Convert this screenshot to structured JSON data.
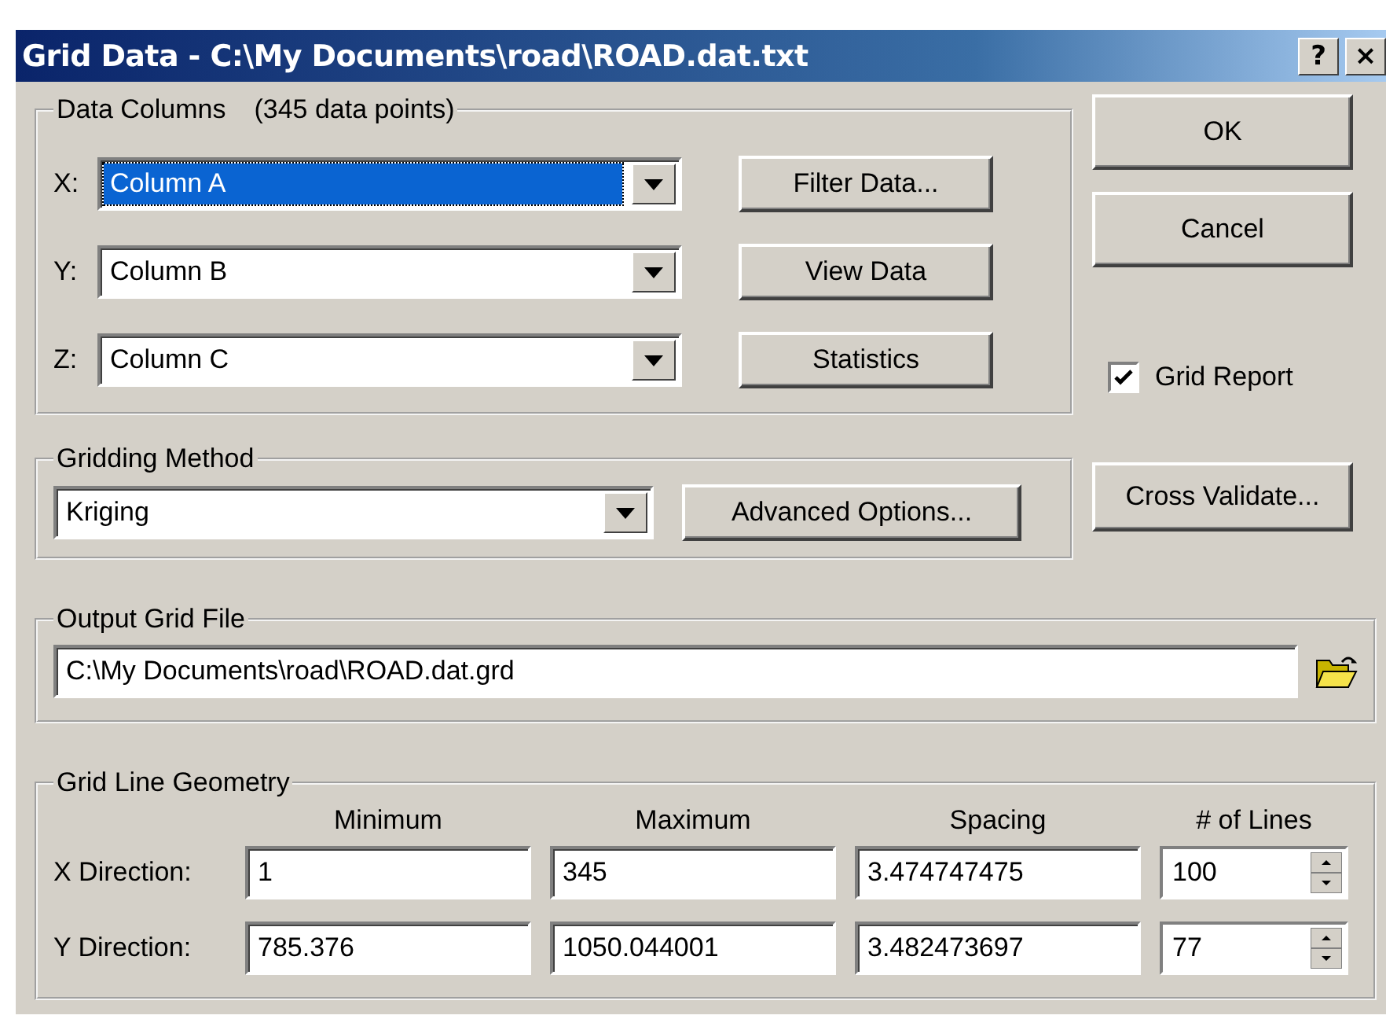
{
  "window": {
    "title": "Grid Data - C:\\My Documents\\road\\ROAD.dat.txt",
    "title_buttons": [
      "?",
      "×"
    ]
  },
  "data_columns": {
    "title": "Data Columns",
    "count": "(345 data points)",
    "rows": [
      {
        "axis": "X:",
        "value": "Column A",
        "focused": true,
        "button": "Filter Data..."
      },
      {
        "axis": "Y:",
        "value": "Column B",
        "focused": false,
        "button": "View Data"
      },
      {
        "axis": "Z:",
        "value": "Column C",
        "focused": false,
        "button": "Statistics"
      }
    ]
  },
  "side_buttons": [
    "OK",
    "Cancel"
  ],
  "grid_report": {
    "label": "Grid Report",
    "checked": true
  },
  "gridding_method": {
    "title": "Gridding Method",
    "value": "Kriging",
    "button": "Advanced Options..."
  },
  "cross_validate": "Cross Validate...",
  "output_grid_file": {
    "title": "Output Grid File",
    "value": "C:\\My Documents\\road\\ROAD.dat.grd"
  },
  "grid_line_geometry": {
    "title": "Grid Line Geometry",
    "columns": [
      "Minimum",
      "Maximum",
      "Spacing",
      "# of Lines"
    ],
    "rows": [
      {
        "label": "X Direction:",
        "values": [
          "1",
          "345",
          "3.474747475",
          "100"
        ]
      },
      {
        "label": "Y Direction:",
        "values": [
          "785.376",
          "1050.044001",
          "3.482473697",
          "77"
        ]
      }
    ]
  }
}
